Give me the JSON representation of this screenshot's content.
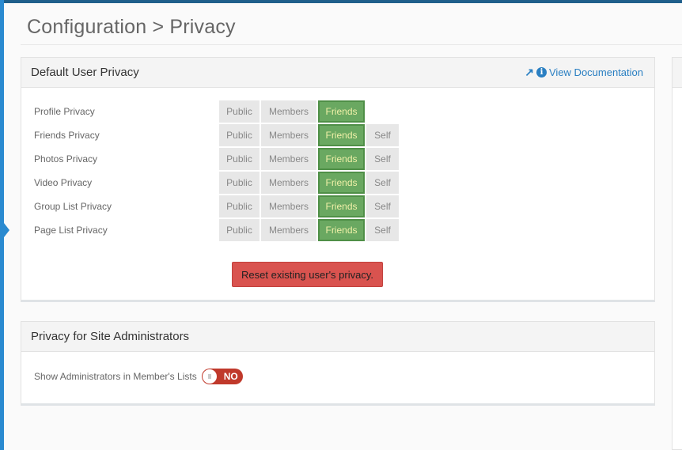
{
  "page": {
    "title": "Configuration > Privacy"
  },
  "default_privacy": {
    "title": "Default User Privacy",
    "doc_link": "View Documentation",
    "options": {
      "public": "Public",
      "members": "Members",
      "friends": "Friends",
      "self": "Self"
    },
    "rows": [
      {
        "label": "Profile Privacy",
        "selected": "Friends",
        "has_self": false
      },
      {
        "label": "Friends Privacy",
        "selected": "Friends",
        "has_self": true
      },
      {
        "label": "Photos Privacy",
        "selected": "Friends",
        "has_self": true
      },
      {
        "label": "Video Privacy",
        "selected": "Friends",
        "has_self": true
      },
      {
        "label": "Group List Privacy",
        "selected": "Friends",
        "has_self": true
      },
      {
        "label": "Page List Privacy",
        "selected": "Friends",
        "has_self": true
      }
    ],
    "reset_label": "Reset existing user's privacy."
  },
  "admin_privacy": {
    "title": "Privacy for Site Administrators",
    "show_admins_label": "Show Administrators in Member's Lists",
    "toggle_state": "NO"
  }
}
